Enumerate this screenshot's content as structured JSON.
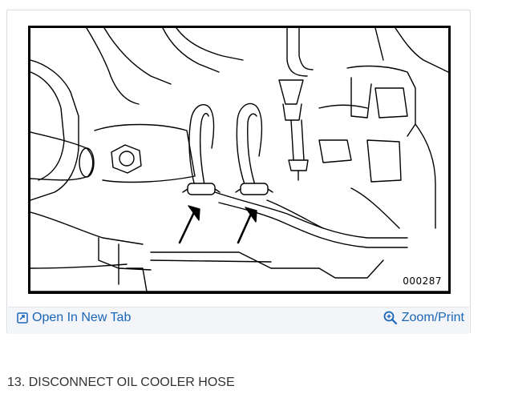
{
  "figure": {
    "id_label": "000287"
  },
  "toolbar": {
    "open_label": "Open In New Tab",
    "zoom_label": "Zoom/Print",
    "accent_color": "#1a66b8"
  },
  "icons": {
    "open": "open-in-new-tab-icon",
    "zoom": "zoom-magnifier-icon"
  },
  "caption": {
    "text": "13. DISCONNECT OIL COOLER HOSE"
  }
}
